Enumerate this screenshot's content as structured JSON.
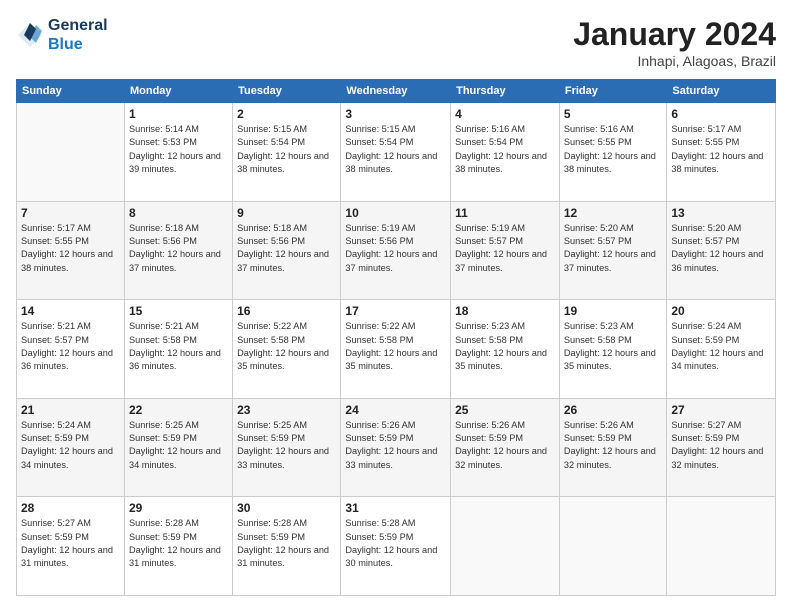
{
  "header": {
    "logo_line1": "General",
    "logo_line2": "Blue",
    "month": "January 2024",
    "location": "Inhapi, Alagoas, Brazil"
  },
  "weekdays": [
    "Sunday",
    "Monday",
    "Tuesday",
    "Wednesday",
    "Thursday",
    "Friday",
    "Saturday"
  ],
  "weeks": [
    [
      {
        "day": null
      },
      {
        "day": "1",
        "sunrise": "5:14 AM",
        "sunset": "5:53 PM",
        "daylight": "12 hours and 39 minutes."
      },
      {
        "day": "2",
        "sunrise": "5:15 AM",
        "sunset": "5:54 PM",
        "daylight": "12 hours and 38 minutes."
      },
      {
        "day": "3",
        "sunrise": "5:15 AM",
        "sunset": "5:54 PM",
        "daylight": "12 hours and 38 minutes."
      },
      {
        "day": "4",
        "sunrise": "5:16 AM",
        "sunset": "5:54 PM",
        "daylight": "12 hours and 38 minutes."
      },
      {
        "day": "5",
        "sunrise": "5:16 AM",
        "sunset": "5:55 PM",
        "daylight": "12 hours and 38 minutes."
      },
      {
        "day": "6",
        "sunrise": "5:17 AM",
        "sunset": "5:55 PM",
        "daylight": "12 hours and 38 minutes."
      }
    ],
    [
      {
        "day": "7",
        "sunrise": "5:17 AM",
        "sunset": "5:55 PM",
        "daylight": "12 hours and 38 minutes."
      },
      {
        "day": "8",
        "sunrise": "5:18 AM",
        "sunset": "5:56 PM",
        "daylight": "12 hours and 37 minutes."
      },
      {
        "day": "9",
        "sunrise": "5:18 AM",
        "sunset": "5:56 PM",
        "daylight": "12 hours and 37 minutes."
      },
      {
        "day": "10",
        "sunrise": "5:19 AM",
        "sunset": "5:56 PM",
        "daylight": "12 hours and 37 minutes."
      },
      {
        "day": "11",
        "sunrise": "5:19 AM",
        "sunset": "5:57 PM",
        "daylight": "12 hours and 37 minutes."
      },
      {
        "day": "12",
        "sunrise": "5:20 AM",
        "sunset": "5:57 PM",
        "daylight": "12 hours and 37 minutes."
      },
      {
        "day": "13",
        "sunrise": "5:20 AM",
        "sunset": "5:57 PM",
        "daylight": "12 hours and 36 minutes."
      }
    ],
    [
      {
        "day": "14",
        "sunrise": "5:21 AM",
        "sunset": "5:57 PM",
        "daylight": "12 hours and 36 minutes."
      },
      {
        "day": "15",
        "sunrise": "5:21 AM",
        "sunset": "5:58 PM",
        "daylight": "12 hours and 36 minutes."
      },
      {
        "day": "16",
        "sunrise": "5:22 AM",
        "sunset": "5:58 PM",
        "daylight": "12 hours and 35 minutes."
      },
      {
        "day": "17",
        "sunrise": "5:22 AM",
        "sunset": "5:58 PM",
        "daylight": "12 hours and 35 minutes."
      },
      {
        "day": "18",
        "sunrise": "5:23 AM",
        "sunset": "5:58 PM",
        "daylight": "12 hours and 35 minutes."
      },
      {
        "day": "19",
        "sunrise": "5:23 AM",
        "sunset": "5:58 PM",
        "daylight": "12 hours and 35 minutes."
      },
      {
        "day": "20",
        "sunrise": "5:24 AM",
        "sunset": "5:59 PM",
        "daylight": "12 hours and 34 minutes."
      }
    ],
    [
      {
        "day": "21",
        "sunrise": "5:24 AM",
        "sunset": "5:59 PM",
        "daylight": "12 hours and 34 minutes."
      },
      {
        "day": "22",
        "sunrise": "5:25 AM",
        "sunset": "5:59 PM",
        "daylight": "12 hours and 34 minutes."
      },
      {
        "day": "23",
        "sunrise": "5:25 AM",
        "sunset": "5:59 PM",
        "daylight": "12 hours and 33 minutes."
      },
      {
        "day": "24",
        "sunrise": "5:26 AM",
        "sunset": "5:59 PM",
        "daylight": "12 hours and 33 minutes."
      },
      {
        "day": "25",
        "sunrise": "5:26 AM",
        "sunset": "5:59 PM",
        "daylight": "12 hours and 32 minutes."
      },
      {
        "day": "26",
        "sunrise": "5:26 AM",
        "sunset": "5:59 PM",
        "daylight": "12 hours and 32 minutes."
      },
      {
        "day": "27",
        "sunrise": "5:27 AM",
        "sunset": "5:59 PM",
        "daylight": "12 hours and 32 minutes."
      }
    ],
    [
      {
        "day": "28",
        "sunrise": "5:27 AM",
        "sunset": "5:59 PM",
        "daylight": "12 hours and 31 minutes."
      },
      {
        "day": "29",
        "sunrise": "5:28 AM",
        "sunset": "5:59 PM",
        "daylight": "12 hours and 31 minutes."
      },
      {
        "day": "30",
        "sunrise": "5:28 AM",
        "sunset": "5:59 PM",
        "daylight": "12 hours and 31 minutes."
      },
      {
        "day": "31",
        "sunrise": "5:28 AM",
        "sunset": "5:59 PM",
        "daylight": "12 hours and 30 minutes."
      },
      {
        "day": null
      },
      {
        "day": null
      },
      {
        "day": null
      }
    ]
  ],
  "row_classes": [
    "row-white",
    "row-shaded",
    "row-white",
    "row-shaded",
    "row-white"
  ]
}
